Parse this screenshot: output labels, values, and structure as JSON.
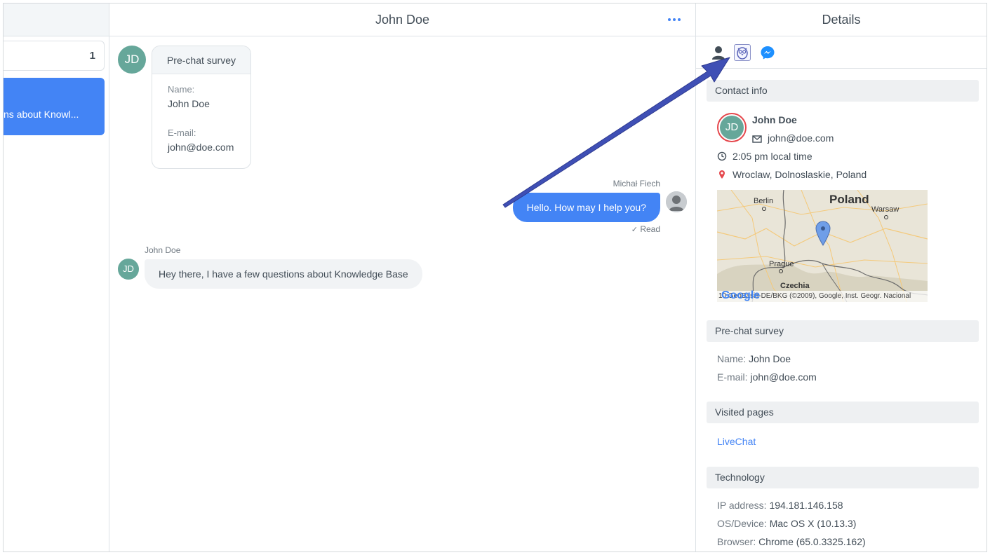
{
  "queue": {
    "count": "1"
  },
  "chat_list": {
    "preview": "ns about Knowl..."
  },
  "chat": {
    "title": "John Doe",
    "survey_card": {
      "avatar_initials": "JD",
      "title": "Pre-chat survey",
      "name_label": "Name:",
      "name_value": "John Doe",
      "email_label": "E-mail:",
      "email_value": "john@doe.com"
    },
    "agent_message": {
      "author": "Michał Fiech",
      "text": "Hello. How may I help you?",
      "status": "Read"
    },
    "customer_message": {
      "author": "John Doe",
      "avatar_initials": "JD",
      "text": "Hey there, I have a few questions about Knowledge Base"
    }
  },
  "details": {
    "title": "Details",
    "tabs": [
      "person-icon",
      "owl-icon",
      "messenger-icon"
    ],
    "contact_info": {
      "header": "Contact info",
      "avatar_initials": "JD",
      "name": "John Doe",
      "email": "john@doe.com",
      "local_time": "2:05 pm local time",
      "location": "Wroclaw, Dolnoslaskie, Poland"
    },
    "map": {
      "country": "Poland",
      "cities": {
        "berlin": "Berlin",
        "warsaw": "Warsaw",
        "prague": "Prague"
      },
      "region": "Czechia",
      "logo": "Google",
      "attribution": "10 GeoBasis-DE/BKG (©2009), Google, Inst. Geogr. Nacional"
    },
    "pre_chat_survey": {
      "header": "Pre-chat survey",
      "name_label": "Name:",
      "name_value": "John Doe",
      "email_label": "E-mail:",
      "email_value": "john@doe.com"
    },
    "visited_pages": {
      "header": "Visited pages",
      "link": "LiveChat"
    },
    "technology": {
      "header": "Technology",
      "ip_label": "IP address:",
      "ip_value": "194.181.146.158",
      "os_label": "OS/Device:",
      "os_value": "Mac OS X (10.13.3)",
      "browser_label": "Browser:",
      "browser_value": "Chrome (65.0.3325.162)"
    }
  },
  "colors": {
    "accent": "#4384f5",
    "avatar": "#66a79a",
    "annotation_arrow": "#3f4fb5"
  }
}
